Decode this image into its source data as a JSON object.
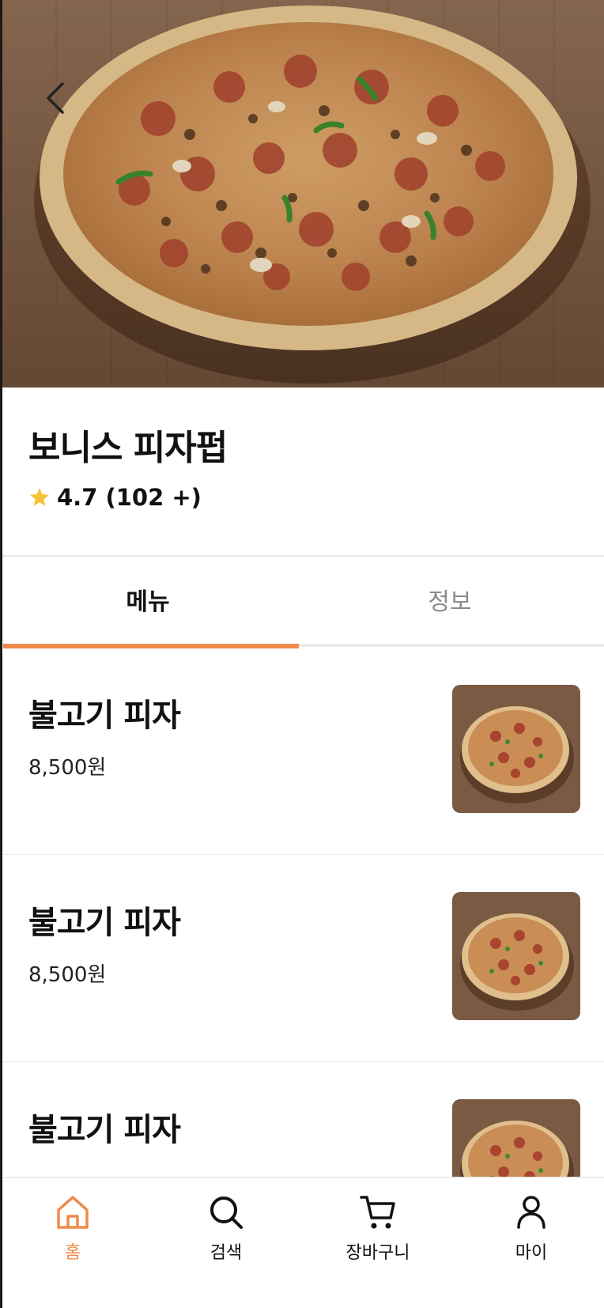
{
  "hero": {
    "image": "pizza-photo",
    "back_icon": "chevron-left-icon"
  },
  "store": {
    "name": "보니스 피자펍",
    "rating_text": "4.7 (102 +)",
    "rating_icon": "star-icon",
    "rating_color": "#F5C33B"
  },
  "tabs": [
    {
      "label": "메뉴",
      "active": true
    },
    {
      "label": "정보",
      "active": false
    }
  ],
  "menu_items": [
    {
      "name": "불고기 피자",
      "price": "8,500원",
      "image": "pizza-thumbnail"
    },
    {
      "name": "불고기 피자",
      "price": "8,500원",
      "image": "pizza-thumbnail"
    },
    {
      "name": "불고기 피자",
      "price": "",
      "image": "pizza-thumbnail"
    }
  ],
  "bottom_nav": [
    {
      "label": "홈",
      "icon": "home-icon",
      "active": true
    },
    {
      "label": "검색",
      "icon": "search-icon",
      "active": false
    },
    {
      "label": "장바구니",
      "icon": "cart-icon",
      "active": false
    },
    {
      "label": "마이",
      "icon": "user-icon",
      "active": false
    }
  ],
  "colors": {
    "accent": "#F08A4B",
    "inactive_tab": "#8B8B8B",
    "divider": "#ECECEC"
  }
}
